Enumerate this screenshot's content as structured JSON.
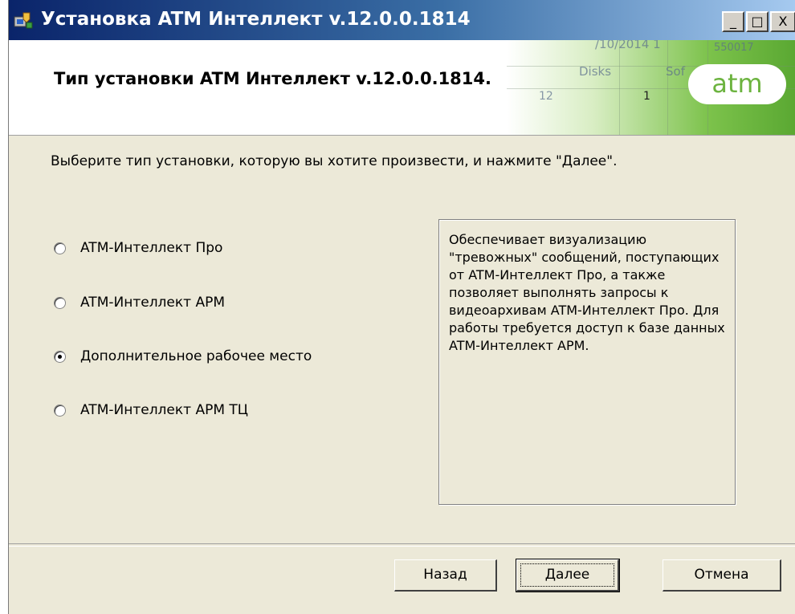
{
  "window": {
    "title": "Установка ATM Интеллект v.12.0.0.1814",
    "controls": {
      "minimize": "_",
      "maximize": "□",
      "close": "X"
    }
  },
  "banner": {
    "heading": "Тип установки ATM Интеллект v.12.0.0.1814.",
    "logo_text": "atm",
    "photo_fragments": [
      "/10/2014 1",
      "550017",
      "Disks",
      "Sof",
      "12",
      "1"
    ],
    "accent_color": "#6cb33f"
  },
  "main": {
    "instruction": "Выберите тип установки, которую вы хотите произвести, и нажмите \"Далее\".",
    "options": [
      {
        "label": "ATM-Интеллект Про",
        "checked": false
      },
      {
        "label": "ATM-Интеллект АРМ",
        "checked": false
      },
      {
        "label": "Дополнительное рабочее место",
        "checked": true
      },
      {
        "label": "ATM-Интеллект АРМ ТЦ",
        "checked": false
      }
    ],
    "description": "Обеспечивает визуализацию \"тревожных\" сообщений, поступающих от ATM-Интеллект Про, а также позволяет выполнять запросы к видеоархивам ATM-Интеллект Про. Для работы требуется доступ к базе данных ATM-Интеллект АРМ."
  },
  "buttons": {
    "back": "Назад",
    "next": "Далее",
    "cancel": "Отмена"
  },
  "icons": {
    "app": "installer-icon"
  }
}
